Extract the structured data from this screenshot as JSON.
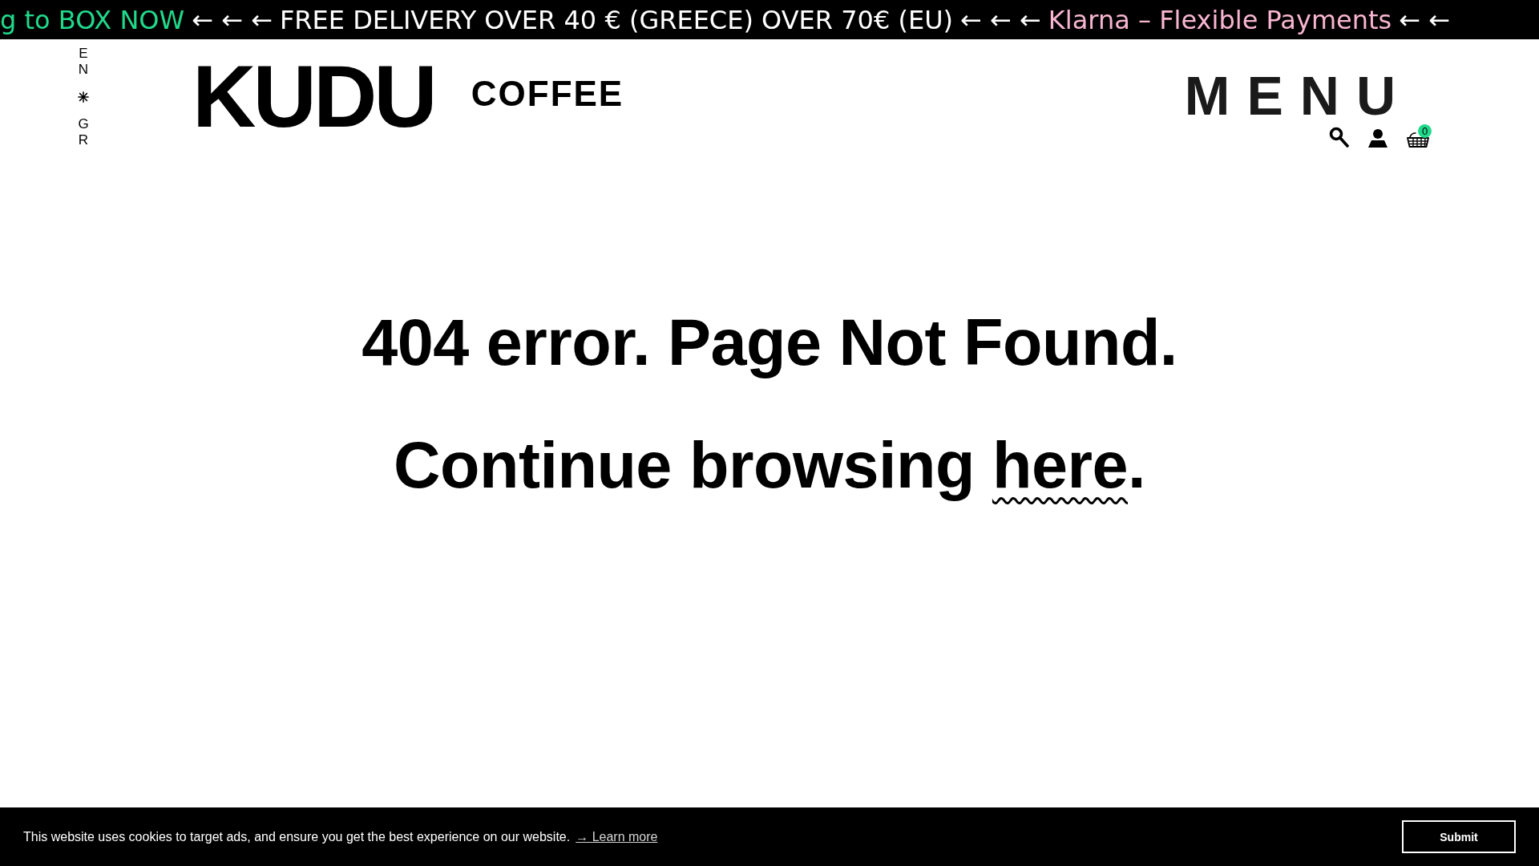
{
  "announcement_bar": {
    "items": [
      {
        "text": "g to BOX NOW",
        "color": "#20d98b",
        "arrows": "← ← ←"
      },
      {
        "text": "FREE DELIVERY OVER 40 € (GREECE) OVER 70€ (EU)",
        "color": "#ffffff",
        "arrows": "← ← ←"
      },
      {
        "text": "Klarna – Flexible Payments",
        "color": "#f8b5d0",
        "arrows": "← ←"
      }
    ]
  },
  "language_switcher": {
    "options": [
      {
        "label": "EN"
      },
      {
        "label": "GR"
      }
    ]
  },
  "header": {
    "logo": {
      "name": "KUDU",
      "tagline": "COFFEE"
    },
    "menu_label": "MENU",
    "cart_count": "0"
  },
  "error": {
    "title": "404 error. Page Not Found.",
    "continue": {
      "before": "Continue browsing ",
      "link": "here",
      "after": "."
    }
  },
  "cookie_bar": {
    "message": "This website uses cookies to target ads, and ensure you get the best experience on our website.",
    "link": "→ Learn more",
    "button": "Submit"
  }
}
